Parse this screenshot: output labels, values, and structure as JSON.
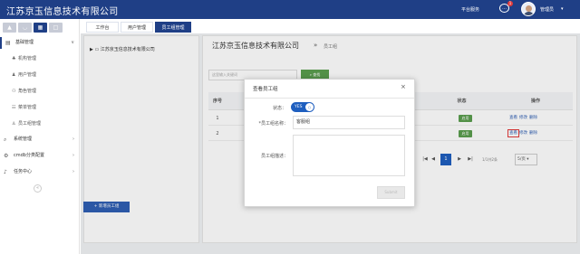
{
  "app": {
    "title": "江苏京玉信息技术有限公司"
  },
  "topbar": {
    "platform_label": "平台服务",
    "message_count": "1",
    "user_name": "管理员",
    "user_caret": "▾"
  },
  "sidebar": {
    "groups": [
      {
        "label": "基础管理",
        "icon": "grid-icon",
        "chevron": "∨"
      },
      {
        "label": "系统管理",
        "icon": "search-icon",
        "chevron": "›"
      },
      {
        "label": "cmdb分类配置",
        "icon": "gear-icon",
        "chevron": "›"
      },
      {
        "label": "任务中心",
        "icon": "bell-icon",
        "chevron": "›"
      }
    ],
    "items": [
      {
        "label": "机构管理",
        "icon": "sitemap-icon"
      },
      {
        "label": "用户管理",
        "icon": "users-icon"
      },
      {
        "label": "角色管理",
        "icon": "role-icon"
      },
      {
        "label": "菜单管理",
        "icon": "menu-icon"
      },
      {
        "label": "员工组管理",
        "icon": "user-group-icon"
      }
    ]
  },
  "tabs": [
    {
      "label": "工作台"
    },
    {
      "label": "用户管理"
    },
    {
      "label": "员工组管理"
    }
  ],
  "tree": {
    "root_label": "江苏京玉信息技术有限公司"
  },
  "main": {
    "breadcrumb_title": "江苏京玉信息技术有限公司",
    "breadcrumb_sep": "»",
    "breadcrumb_sub": "员工组",
    "search_placeholder": "这里输入关键词",
    "search_button": "查找",
    "add_button": "+ 新增员工组"
  },
  "table": {
    "headers": {
      "seq": "序号",
      "status": "状态",
      "ops": "操作"
    },
    "rows": [
      {
        "seq": "1",
        "status": "启用",
        "op_view": "查看",
        "op_edit": "修改",
        "op_delete": "删除"
      },
      {
        "seq": "2",
        "status": "启用",
        "op_view": "查看",
        "op_edit": "修改",
        "op_delete": "删除"
      }
    ]
  },
  "pager": {
    "first": "|◀",
    "prev": "◀",
    "current_page": "1",
    "next": "▶",
    "last": "▶|",
    "info": "1/1共2条",
    "page_size": "5/页 ▾"
  },
  "modal": {
    "title": "查看员工组",
    "close": "×",
    "status_label": "状态：",
    "toggle_text": "YES",
    "name_label": "*员工组名称：",
    "name_value": "客服组",
    "desc_label": "员工组描述：",
    "submit_button": "Submit"
  },
  "colors": {
    "primary": "#1f3f86",
    "accent": "#1f5fbf",
    "success": "#5b9e4f",
    "danger": "#e23b3b"
  }
}
